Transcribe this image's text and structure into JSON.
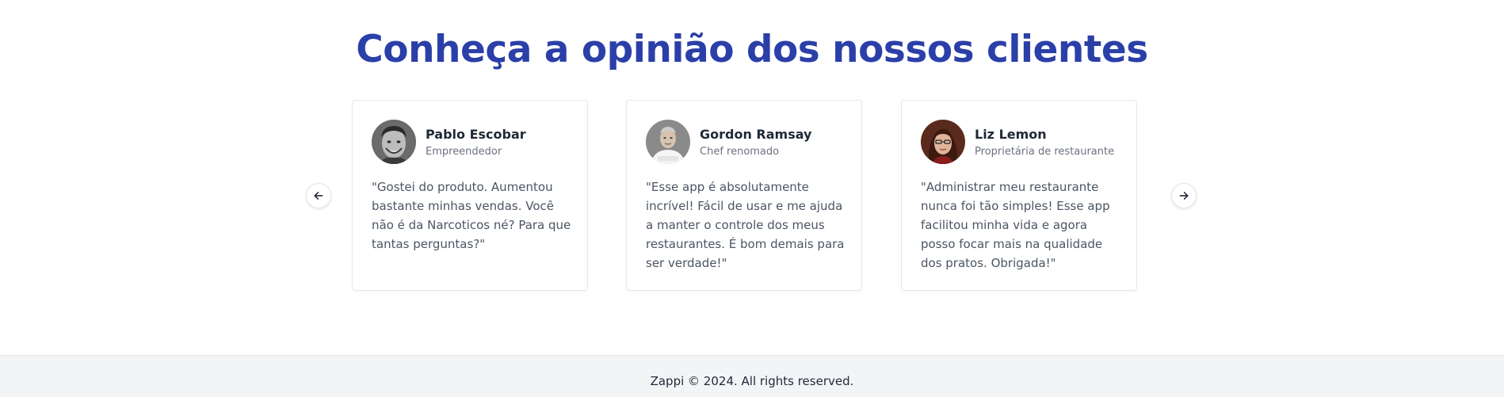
{
  "section": {
    "title": "Conheça a opinião dos nossos clientes"
  },
  "carousel": {
    "prev_icon": "arrow-left-icon",
    "next_icon": "arrow-right-icon"
  },
  "testimonials": [
    {
      "name": "Pablo Escobar",
      "role": "Empreendedor",
      "quote": "\"Gostei do produto. Aumentou bastante minhas vendas. Você não é da Narcoticos né? Para que tantas perguntas?\"",
      "avatar": "avatar-photo-grayscale"
    },
    {
      "name": "Gordon Ramsay",
      "role": "Chef renomado",
      "quote": "\"Esse app é absolutamente incrível! Fácil de usar e me ajuda a manter o controle dos meus restaurantes. É bom demais para ser verdade!\"",
      "avatar": "avatar-photo-chef"
    },
    {
      "name": "Liz Lemon",
      "role": "Proprietária de restaurante",
      "quote": "\"Administrar meu restaurante nunca foi tão simples! Esse app facilitou minha vida e agora posso focar mais na qualidade dos pratos. Obrigada!\"",
      "avatar": "avatar-photo-woman"
    }
  ],
  "footer": {
    "text": "Zappi © 2024. All rights reserved."
  },
  "colors": {
    "accent": "#2b3fa8",
    "footer_bg": "#f3f4f6",
    "card_border": "#e5e7eb"
  }
}
